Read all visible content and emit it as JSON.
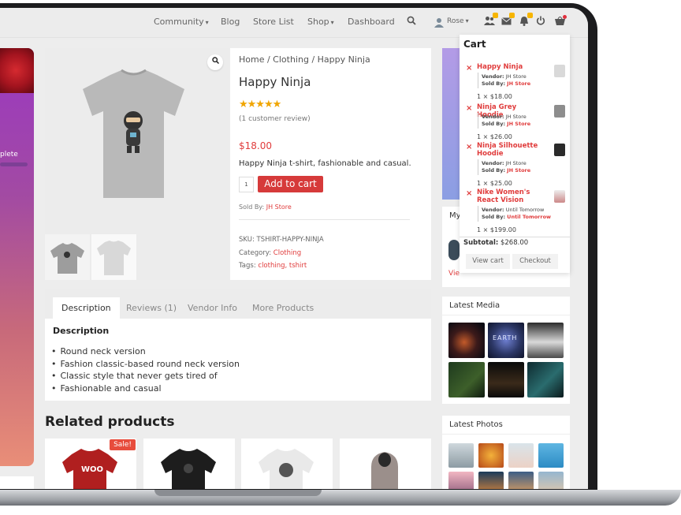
{
  "nav": {
    "items": [
      "Community",
      "Blog",
      "Store List",
      "Shop",
      "Dashboard"
    ],
    "user": "Rose"
  },
  "left": {
    "partial_text": "plete"
  },
  "gallery": {
    "zoom_icon": "search-icon"
  },
  "product": {
    "breadcrumb": "Home / Clothing / Happy Ninja",
    "title": "Happy Ninja",
    "rating_stars": "★★★★★",
    "rating": 5,
    "review_count": "(1 customer review)",
    "price": "$18.00",
    "short_desc": "Happy Ninja t-shirt, fashionable and casual.",
    "qty": "1",
    "add_to_cart": "Add to cart",
    "sold_by_label": "Sold By:",
    "sold_by": "JH Store",
    "sku_line": "SKU: TSHIRT-HAPPY-NINJA",
    "category_label": "Category:",
    "category": "Clothing",
    "tags_label": "Tags:",
    "tags": "clothing, tshirt"
  },
  "tabs": [
    {
      "label": "Description",
      "active": true
    },
    {
      "label": "Reviews (1)"
    },
    {
      "label": "Vendor Info"
    },
    {
      "label": "More Products"
    }
  ],
  "description": {
    "title": "Description",
    "bullets": [
      "Round neck version",
      "Fashion classic-based round neck version",
      "Classic style that never gets tired of",
      "Fashionable and casual"
    ]
  },
  "related": {
    "title": "Related products",
    "sale_badge": "Sale!"
  },
  "cart": {
    "title": "Cart",
    "vendor_label": "Vendor:",
    "soldby_label": "Sold By:",
    "items": [
      {
        "name": "Happy Ninja",
        "vendor": "JH Store",
        "sold_by": "JH Store",
        "qty": "1 × $18.00"
      },
      {
        "name": "Ninja Grey Hoodie",
        "vendor": "JH Store",
        "sold_by": "JH Store",
        "qty": "1 × $26.00"
      },
      {
        "name": "Ninja Silhouette Hoodie",
        "vendor": "JH Store",
        "sold_by": "JH Store",
        "qty": "1 × $25.00"
      },
      {
        "name": "Nike Women's React Vision",
        "vendor": "Until Tomorrow",
        "sold_by": "Until Tomorrow",
        "qty": "1 × $199.00"
      }
    ],
    "subtotal_label": "Subtotal:",
    "subtotal": "$268.00",
    "view_cart": "View cart",
    "checkout": "Checkout"
  },
  "sidebar": {
    "my_label": "My",
    "view_partial": "Vie",
    "latest_media": "Latest Media",
    "media_earth": "EARTH",
    "latest_photos": "Latest Photos"
  },
  "colors": {
    "accent": "#d63a3a",
    "link": "#e03c3c"
  }
}
